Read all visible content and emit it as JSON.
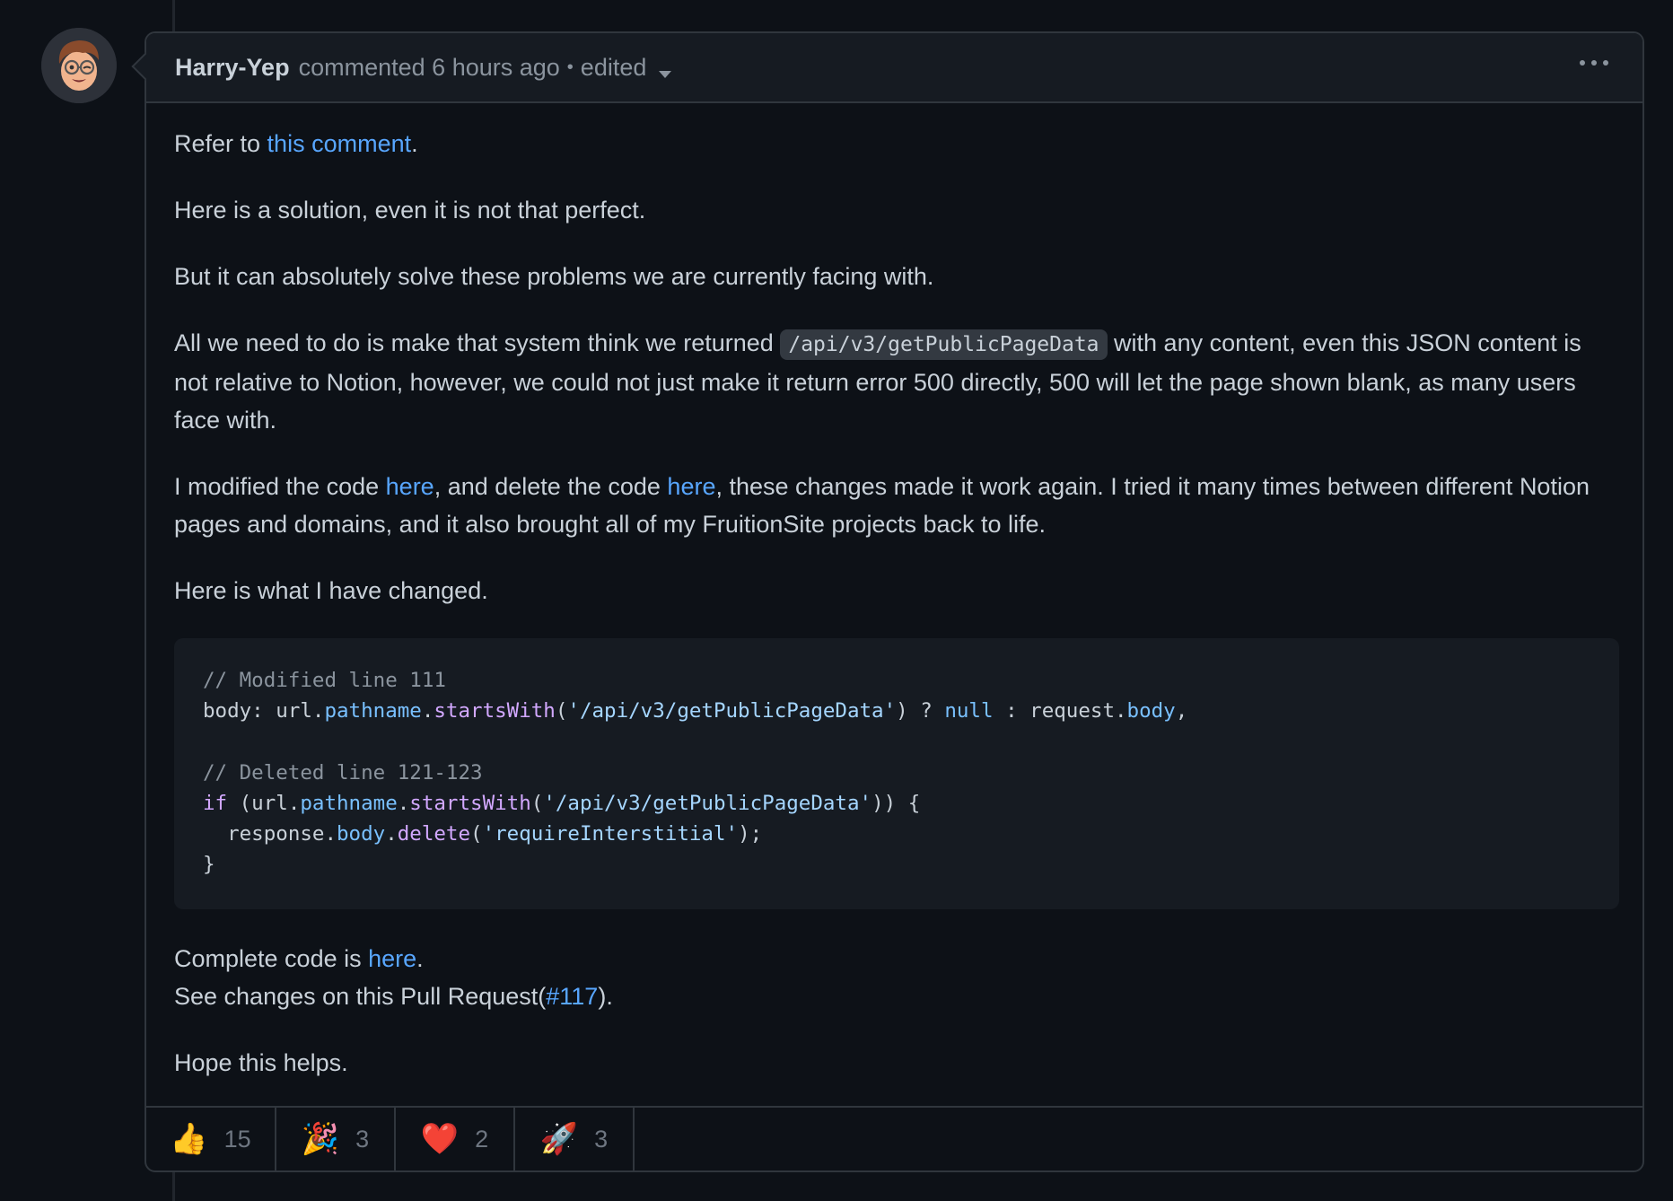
{
  "comment": {
    "author": "Harry-Yep",
    "action": "commented",
    "time": "6 hours ago",
    "separator": "•",
    "edited_label": "edited",
    "avatar_icon": "memoji-avatar",
    "more_options_icon": "kebab-horizontal-icon"
  },
  "body": {
    "p1": {
      "before": "Refer to ",
      "link": "this comment",
      "after": "."
    },
    "p2": "Here is a solution, even it is not that perfect.",
    "p3": "But it can absolutely solve these problems we are currently facing with.",
    "p4": {
      "before": "All we need to do is make that system think we returned ",
      "code": "/api/v3/getPublicPageData",
      "after": " with any content, even this JSON content is not relative to Notion, however, we could not just make it return error 500 directly, 500 will let the page shown blank, as many users face with."
    },
    "p5": {
      "t1": "I modified the code ",
      "link1": "here",
      "t2": ", and delete the code ",
      "link2": "here",
      "t3": ", these changes made it work again. I tried it many times between different Notion pages and domains, and it also brought all of my FruitionSite projects back to life."
    },
    "p6": "Here is what I have changed.",
    "code_block": {
      "comment1": "// Modified line 111",
      "line2": {
        "a": "body: url.",
        "prop1": "pathname",
        "dot": ".",
        "func": "startsWith",
        "open": "(",
        "str": "'/api/v3/getPublicPageData'",
        "mid": ") ? ",
        "null": "null",
        "colon": " : request.",
        "prop2": "body",
        "end": ","
      },
      "comment2": "// Deleted line 121-123",
      "line5": {
        "kw": "if",
        "a": " (url.",
        "prop1": "pathname",
        "dot": ".",
        "func": "startsWith",
        "open": "(",
        "str": "'/api/v3/getPublicPageData'",
        "end": ")) {"
      },
      "line6": {
        "a": "  response.",
        "prop": "body",
        "dot": ".",
        "func": "delete",
        "open": "(",
        "str": "'requireInterstitial'",
        "end": ");"
      },
      "line7": "}"
    },
    "p7": {
      "before": "Complete code is ",
      "link": "here",
      "after": "."
    },
    "p8": {
      "before": "See changes on this Pull Request(",
      "link": "#117",
      "after": ")."
    },
    "p9": "Hope this helps."
  },
  "reactions": [
    {
      "name": "thumbs-up",
      "emoji": "👍",
      "count": "15"
    },
    {
      "name": "hooray",
      "emoji": "🎉",
      "count": "3"
    },
    {
      "name": "heart",
      "emoji": "❤️",
      "count": "2"
    },
    {
      "name": "rocket",
      "emoji": "🚀",
      "count": "3"
    }
  ],
  "colors": {
    "background": "#0d1117",
    "header_bg": "#161b22",
    "border": "#30363d",
    "link": "#58a6ff",
    "text": "#c9d1d9",
    "muted": "#8b949e"
  }
}
